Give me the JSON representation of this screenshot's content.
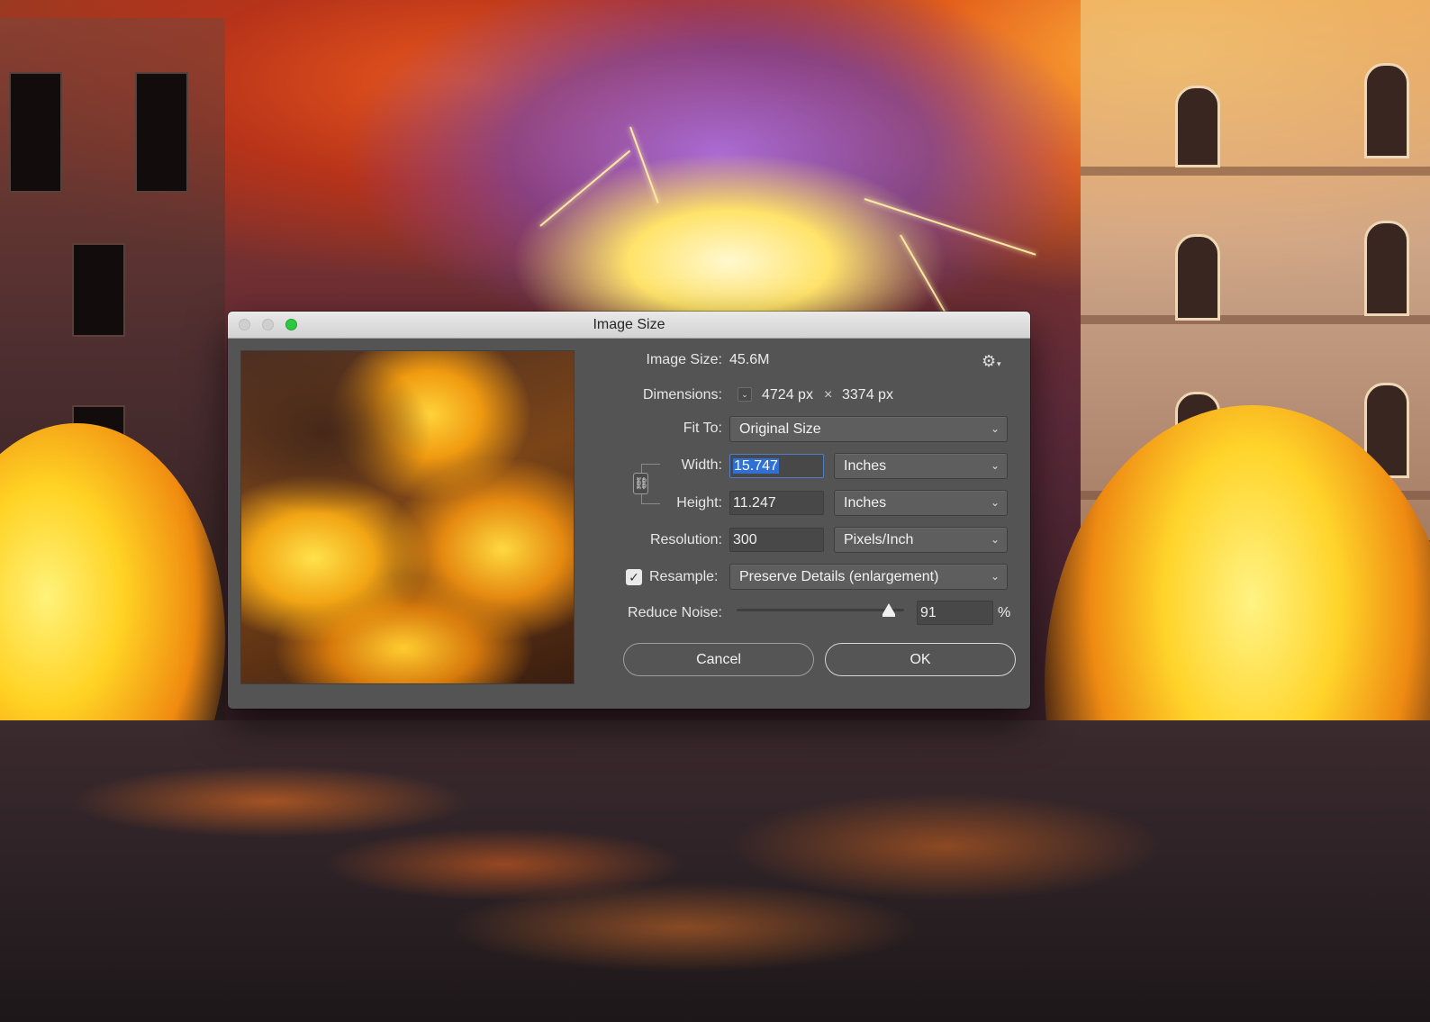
{
  "dialog": {
    "title": "Image Size",
    "image_size": {
      "label": "Image Size:",
      "value": "45.6M"
    },
    "dimensions": {
      "label": "Dimensions:",
      "width_px": "4724 px",
      "separator": "×",
      "height_px": "3374 px"
    },
    "fit_to": {
      "label": "Fit To:",
      "value": "Original Size"
    },
    "width": {
      "label": "Width:",
      "value": "15.747",
      "unit": "Inches"
    },
    "height": {
      "label": "Height:",
      "value": "11.247",
      "unit": "Inches"
    },
    "resolution": {
      "label": "Resolution:",
      "value": "300",
      "unit": "Pixels/Inch"
    },
    "resample": {
      "label": "Resample:",
      "checked": true,
      "value": "Preserve Details (enlargement)"
    },
    "reduce_noise": {
      "label": "Reduce Noise:",
      "value": "91",
      "unit": "%",
      "level": 0.91
    },
    "buttons": {
      "cancel": "Cancel",
      "ok": "OK"
    }
  },
  "icons": {
    "settings": "gear-icon",
    "link": "chain-link-icon",
    "dropdown": "chevron-down-icon",
    "check": "checkmark-icon"
  },
  "colors": {
    "dialog_bg": "#545454",
    "titlebar": "#dcdcdc",
    "zoom_button": "#2cc840",
    "selection": "#2f6fd6"
  }
}
